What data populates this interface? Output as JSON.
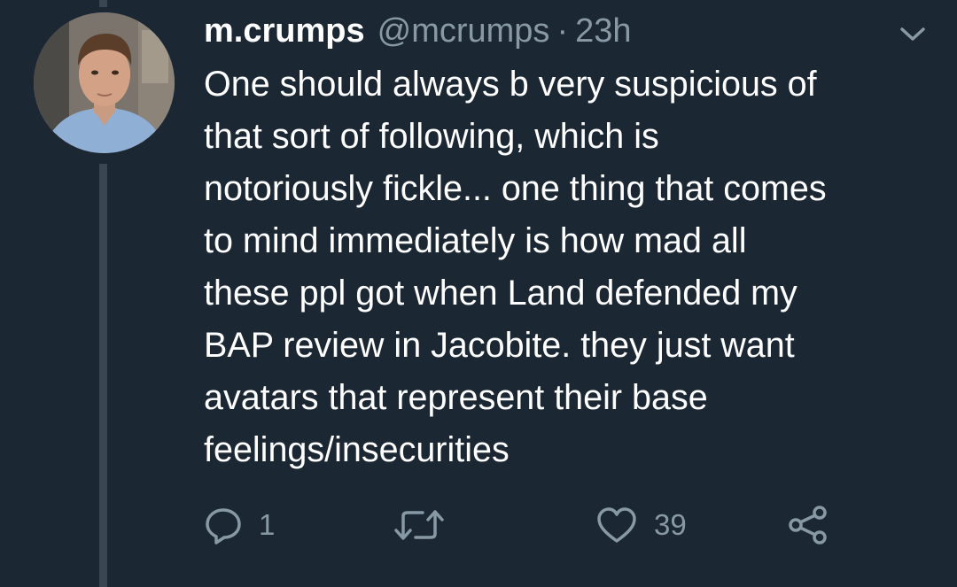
{
  "tweet": {
    "display_name": "m.crumps",
    "handle": "@mcrumps",
    "separator": "·",
    "time": "23h",
    "body_lines": [
      "One should always b very suspicious of",
      "that sort of following, which is",
      "notoriously fickle... one thing that comes",
      "to mind immediately is how mad all",
      "these ppl got when Land defended my",
      "BAP review in Jacobite. they just want",
      "avatars that represent their base",
      "feelings/insecurities"
    ],
    "actions": {
      "reply_count": "1",
      "retweet_count": "",
      "like_count": "39"
    }
  },
  "icons": {
    "menu": "chevron-down-icon",
    "reply": "reply-icon",
    "retweet": "retweet-icon",
    "like": "heart-icon",
    "share": "share-icon"
  },
  "colors": {
    "background": "#1c2734",
    "text": "#ffffff",
    "secondary": "#8899a6",
    "thread_line": "#3a4651"
  }
}
